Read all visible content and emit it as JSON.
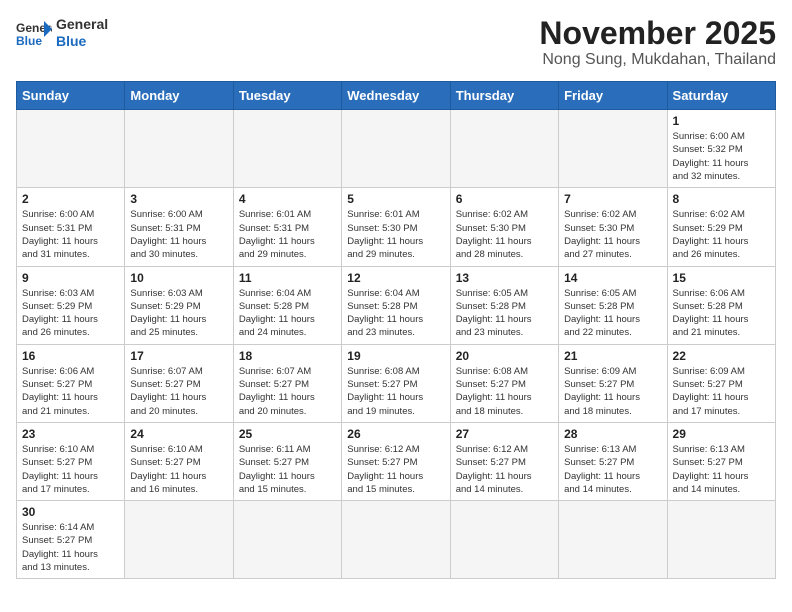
{
  "header": {
    "title": "November 2025",
    "subtitle": "Nong Sung, Mukdahan, Thailand"
  },
  "logo": {
    "general": "General",
    "blue": "Blue"
  },
  "days_of_week": [
    "Sunday",
    "Monday",
    "Tuesday",
    "Wednesday",
    "Thursday",
    "Friday",
    "Saturday"
  ],
  "weeks": [
    [
      {
        "day": "",
        "info": ""
      },
      {
        "day": "",
        "info": ""
      },
      {
        "day": "",
        "info": ""
      },
      {
        "day": "",
        "info": ""
      },
      {
        "day": "",
        "info": ""
      },
      {
        "day": "",
        "info": ""
      },
      {
        "day": "1",
        "info": "Sunrise: 6:00 AM\nSunset: 5:32 PM\nDaylight: 11 hours\nand 32 minutes."
      }
    ],
    [
      {
        "day": "2",
        "info": "Sunrise: 6:00 AM\nSunset: 5:31 PM\nDaylight: 11 hours\nand 31 minutes."
      },
      {
        "day": "3",
        "info": "Sunrise: 6:00 AM\nSunset: 5:31 PM\nDaylight: 11 hours\nand 30 minutes."
      },
      {
        "day": "4",
        "info": "Sunrise: 6:01 AM\nSunset: 5:31 PM\nDaylight: 11 hours\nand 29 minutes."
      },
      {
        "day": "5",
        "info": "Sunrise: 6:01 AM\nSunset: 5:30 PM\nDaylight: 11 hours\nand 29 minutes."
      },
      {
        "day": "6",
        "info": "Sunrise: 6:02 AM\nSunset: 5:30 PM\nDaylight: 11 hours\nand 28 minutes."
      },
      {
        "day": "7",
        "info": "Sunrise: 6:02 AM\nSunset: 5:30 PM\nDaylight: 11 hours\nand 27 minutes."
      },
      {
        "day": "8",
        "info": "Sunrise: 6:02 AM\nSunset: 5:29 PM\nDaylight: 11 hours\nand 26 minutes."
      }
    ],
    [
      {
        "day": "9",
        "info": "Sunrise: 6:03 AM\nSunset: 5:29 PM\nDaylight: 11 hours\nand 26 minutes."
      },
      {
        "day": "10",
        "info": "Sunrise: 6:03 AM\nSunset: 5:29 PM\nDaylight: 11 hours\nand 25 minutes."
      },
      {
        "day": "11",
        "info": "Sunrise: 6:04 AM\nSunset: 5:28 PM\nDaylight: 11 hours\nand 24 minutes."
      },
      {
        "day": "12",
        "info": "Sunrise: 6:04 AM\nSunset: 5:28 PM\nDaylight: 11 hours\nand 23 minutes."
      },
      {
        "day": "13",
        "info": "Sunrise: 6:05 AM\nSunset: 5:28 PM\nDaylight: 11 hours\nand 23 minutes."
      },
      {
        "day": "14",
        "info": "Sunrise: 6:05 AM\nSunset: 5:28 PM\nDaylight: 11 hours\nand 22 minutes."
      },
      {
        "day": "15",
        "info": "Sunrise: 6:06 AM\nSunset: 5:28 PM\nDaylight: 11 hours\nand 21 minutes."
      }
    ],
    [
      {
        "day": "16",
        "info": "Sunrise: 6:06 AM\nSunset: 5:27 PM\nDaylight: 11 hours\nand 21 minutes."
      },
      {
        "day": "17",
        "info": "Sunrise: 6:07 AM\nSunset: 5:27 PM\nDaylight: 11 hours\nand 20 minutes."
      },
      {
        "day": "18",
        "info": "Sunrise: 6:07 AM\nSunset: 5:27 PM\nDaylight: 11 hours\nand 20 minutes."
      },
      {
        "day": "19",
        "info": "Sunrise: 6:08 AM\nSunset: 5:27 PM\nDaylight: 11 hours\nand 19 minutes."
      },
      {
        "day": "20",
        "info": "Sunrise: 6:08 AM\nSunset: 5:27 PM\nDaylight: 11 hours\nand 18 minutes."
      },
      {
        "day": "21",
        "info": "Sunrise: 6:09 AM\nSunset: 5:27 PM\nDaylight: 11 hours\nand 18 minutes."
      },
      {
        "day": "22",
        "info": "Sunrise: 6:09 AM\nSunset: 5:27 PM\nDaylight: 11 hours\nand 17 minutes."
      }
    ],
    [
      {
        "day": "23",
        "info": "Sunrise: 6:10 AM\nSunset: 5:27 PM\nDaylight: 11 hours\nand 17 minutes."
      },
      {
        "day": "24",
        "info": "Sunrise: 6:10 AM\nSunset: 5:27 PM\nDaylight: 11 hours\nand 16 minutes."
      },
      {
        "day": "25",
        "info": "Sunrise: 6:11 AM\nSunset: 5:27 PM\nDaylight: 11 hours\nand 15 minutes."
      },
      {
        "day": "26",
        "info": "Sunrise: 6:12 AM\nSunset: 5:27 PM\nDaylight: 11 hours\nand 15 minutes."
      },
      {
        "day": "27",
        "info": "Sunrise: 6:12 AM\nSunset: 5:27 PM\nDaylight: 11 hours\nand 14 minutes."
      },
      {
        "day": "28",
        "info": "Sunrise: 6:13 AM\nSunset: 5:27 PM\nDaylight: 11 hours\nand 14 minutes."
      },
      {
        "day": "29",
        "info": "Sunrise: 6:13 AM\nSunset: 5:27 PM\nDaylight: 11 hours\nand 14 minutes."
      }
    ],
    [
      {
        "day": "30",
        "info": "Sunrise: 6:14 AM\nSunset: 5:27 PM\nDaylight: 11 hours\nand 13 minutes."
      },
      {
        "day": "",
        "info": ""
      },
      {
        "day": "",
        "info": ""
      },
      {
        "day": "",
        "info": ""
      },
      {
        "day": "",
        "info": ""
      },
      {
        "day": "",
        "info": ""
      },
      {
        "day": "",
        "info": ""
      }
    ]
  ]
}
